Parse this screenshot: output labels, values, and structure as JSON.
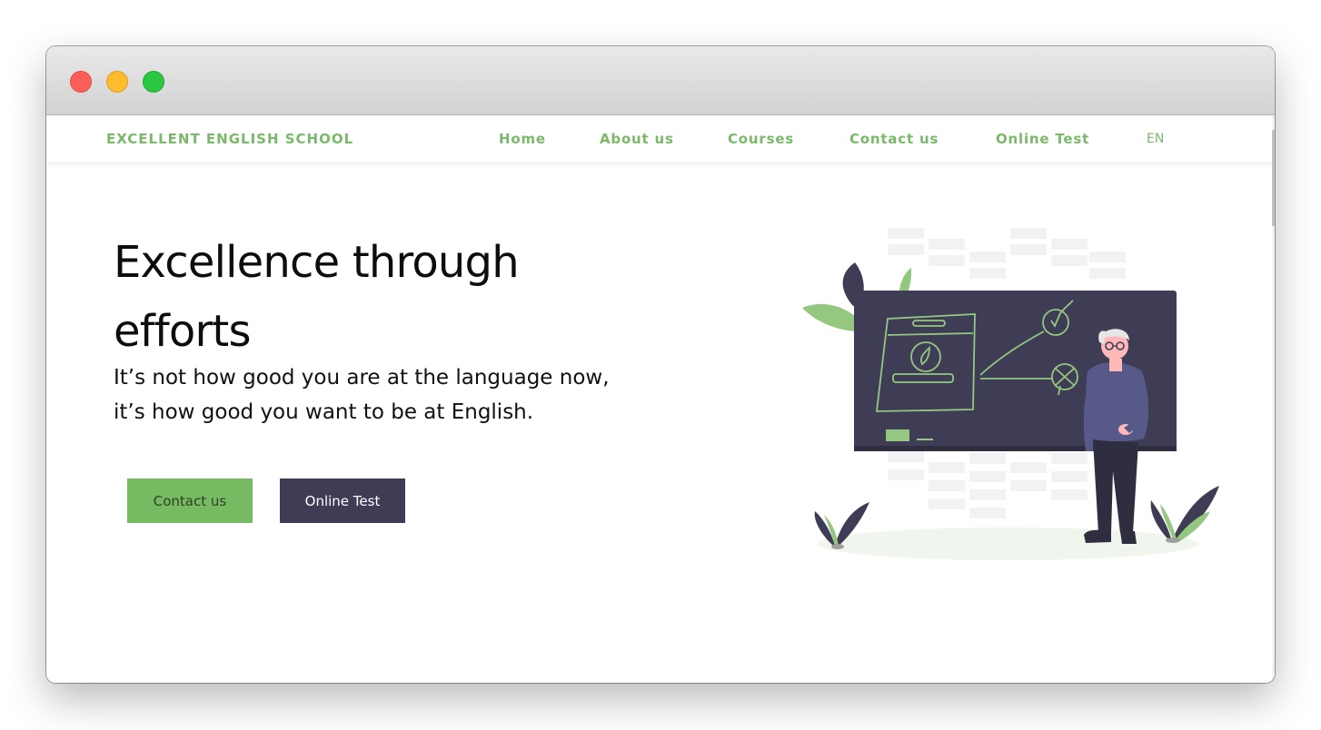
{
  "nav": {
    "brand": "EXCELLENT ENGLISH SCHOOL",
    "links": [
      "Home",
      "About us",
      "Courses",
      "Contact us",
      "Online Test"
    ],
    "language": "EN"
  },
  "hero": {
    "title_line1": "Excellence through",
    "title_line2": "efforts",
    "subtitle_line1": "It’s not how good you are at the language now,",
    "subtitle_line2": "it’s how good you want to be at English.",
    "buttons": {
      "contact": "Contact us",
      "test": "Online Test"
    }
  },
  "colors": {
    "brand_green": "#76bb62",
    "dark_navy": "#3f3d56"
  },
  "icons": [
    "close-window-icon",
    "minimize-window-icon",
    "maximize-window-icon",
    "teacher-chalkboard-illustration"
  ]
}
